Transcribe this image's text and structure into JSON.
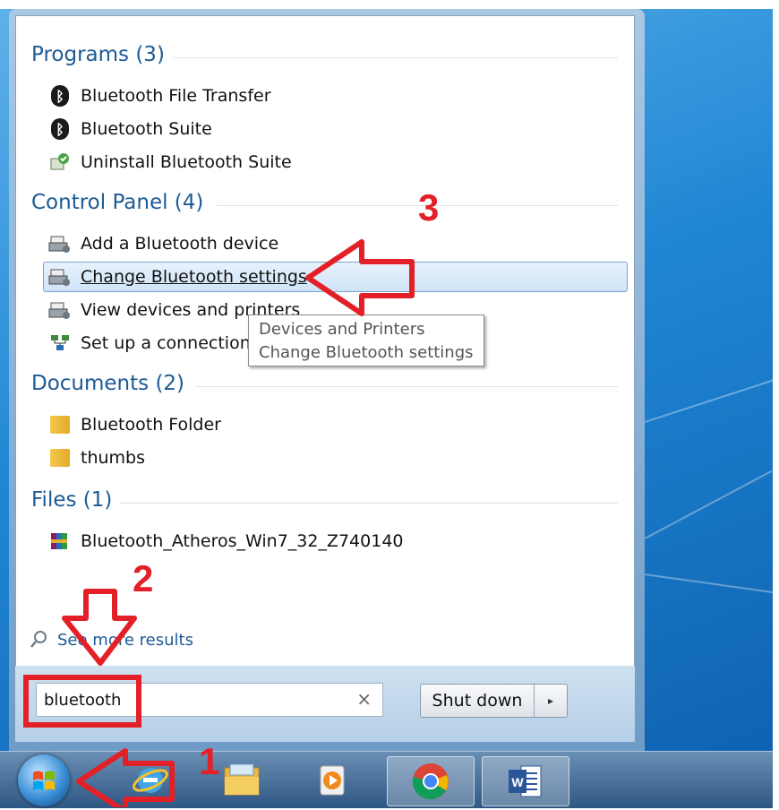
{
  "start_menu": {
    "sections": {
      "programs": {
        "title": "Programs (3)",
        "items": [
          {
            "label": "Bluetooth File Transfer",
            "icon": "bluetooth-icon"
          },
          {
            "label": "Bluetooth Suite",
            "icon": "bluetooth-icon"
          },
          {
            "label": "Uninstall Bluetooth Suite",
            "icon": "uninstall-icon"
          }
        ]
      },
      "control_panel": {
        "title": "Control Panel (4)",
        "items": [
          {
            "label": "Add a Bluetooth device",
            "icon": "printer-device-icon"
          },
          {
            "label": "Change Bluetooth settings",
            "icon": "printer-device-icon"
          },
          {
            "label": "View devices and printers",
            "icon": "printer-device-icon"
          },
          {
            "label": "Set up a connection",
            "icon": "network-connection-icon"
          }
        ]
      },
      "documents": {
        "title": "Documents (2)",
        "items": [
          {
            "label": "Bluetooth Folder",
            "icon": "folder-icon"
          },
          {
            "label": "thumbs",
            "icon": "folder-icon"
          }
        ]
      },
      "files": {
        "title": "Files (1)",
        "items": [
          {
            "label": "Bluetooth_Atheros_Win7_32_Z740140",
            "icon": "archive-icon"
          }
        ]
      }
    },
    "tooltip": {
      "line1": "Devices and Printers",
      "line2": "Change Bluetooth settings"
    },
    "see_more": "See more results",
    "search": {
      "value": "bluetooth",
      "clear": "×"
    },
    "shutdown": {
      "label": "Shut down",
      "arrow": "▸"
    }
  },
  "annotations": {
    "step1": "1",
    "step2": "2",
    "step3": "3",
    "color": "#e32028"
  },
  "taskbar": {
    "items": [
      "start-orb",
      "internet-explorer-icon",
      "file-explorer-icon",
      "media-player-icon",
      "chrome-icon",
      "word-icon"
    ]
  }
}
